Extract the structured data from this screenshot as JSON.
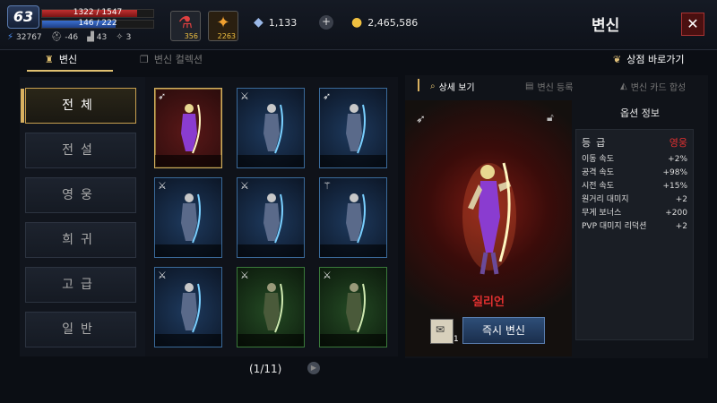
{
  "hud": {
    "level": "63",
    "hp": "1322 / 1547",
    "hp_fraction": 0.855,
    "mp": "146 / 222",
    "mp_fraction": 0.658,
    "stats": [
      {
        "icon": "power-icon",
        "value": "32767"
      },
      {
        "icon": "helmet-icon",
        "value": "-46"
      },
      {
        "icon": "boot-icon",
        "value": "43"
      },
      {
        "icon": "wing-icon",
        "value": "3"
      }
    ],
    "potion_red_count": "356",
    "potion_gold_count": "2263",
    "crystal": "1,133",
    "gold": "2,465,586",
    "plus": "+"
  },
  "window": {
    "title": "변신",
    "close": "✕"
  },
  "tabs": {
    "main": "변신",
    "collection": "변신 컬렉션",
    "shop": "상점 바로가기"
  },
  "categories": [
    "전체",
    "전설",
    "영웅",
    "희귀",
    "고급",
    "일반"
  ],
  "grid": {
    "cards": [
      {
        "rarity": "legend",
        "class_icon": "bow-icon"
      },
      {
        "rarity": "epic",
        "class_icon": "sword-icon"
      },
      {
        "rarity": "epic",
        "class_icon": "bow-icon"
      },
      {
        "rarity": "epic",
        "class_icon": "sword-icon"
      },
      {
        "rarity": "epic",
        "class_icon": "sword-icon"
      },
      {
        "rarity": "epic",
        "class_icon": "staff-icon"
      },
      {
        "rarity": "epic",
        "class_icon": "sword-icon"
      },
      {
        "rarity": "rare",
        "class_icon": "sword-icon"
      },
      {
        "rarity": "rare",
        "class_icon": "sword-icon"
      }
    ],
    "pager": "(1/11)"
  },
  "detail": {
    "tabs": {
      "view": "상세 보기",
      "register": "변신 등록",
      "card_combine": "변신 카드 합성"
    },
    "name": "질리언",
    "card_count": "1",
    "transform_button": "즉시 변신",
    "options_title": "옵션 정보",
    "grade_label": "등급",
    "grade_value": "영웅",
    "options": [
      {
        "label": "이동 속도",
        "value": "+2%"
      },
      {
        "label": "공격 속도",
        "value": "+98%"
      },
      {
        "label": "시전 속도",
        "value": "+15%"
      },
      {
        "label": "원거리 대미지",
        "value": "+2"
      },
      {
        "label": "무게 보너스",
        "value": "+200"
      },
      {
        "label": "PVP 대미지 리덕션",
        "value": "+2"
      }
    ]
  },
  "colors": {
    "legend_border": "#d4b060",
    "epic_bg": "#1e3a5e",
    "rare_bg": "#244a24",
    "grade_color": "#e03030"
  }
}
